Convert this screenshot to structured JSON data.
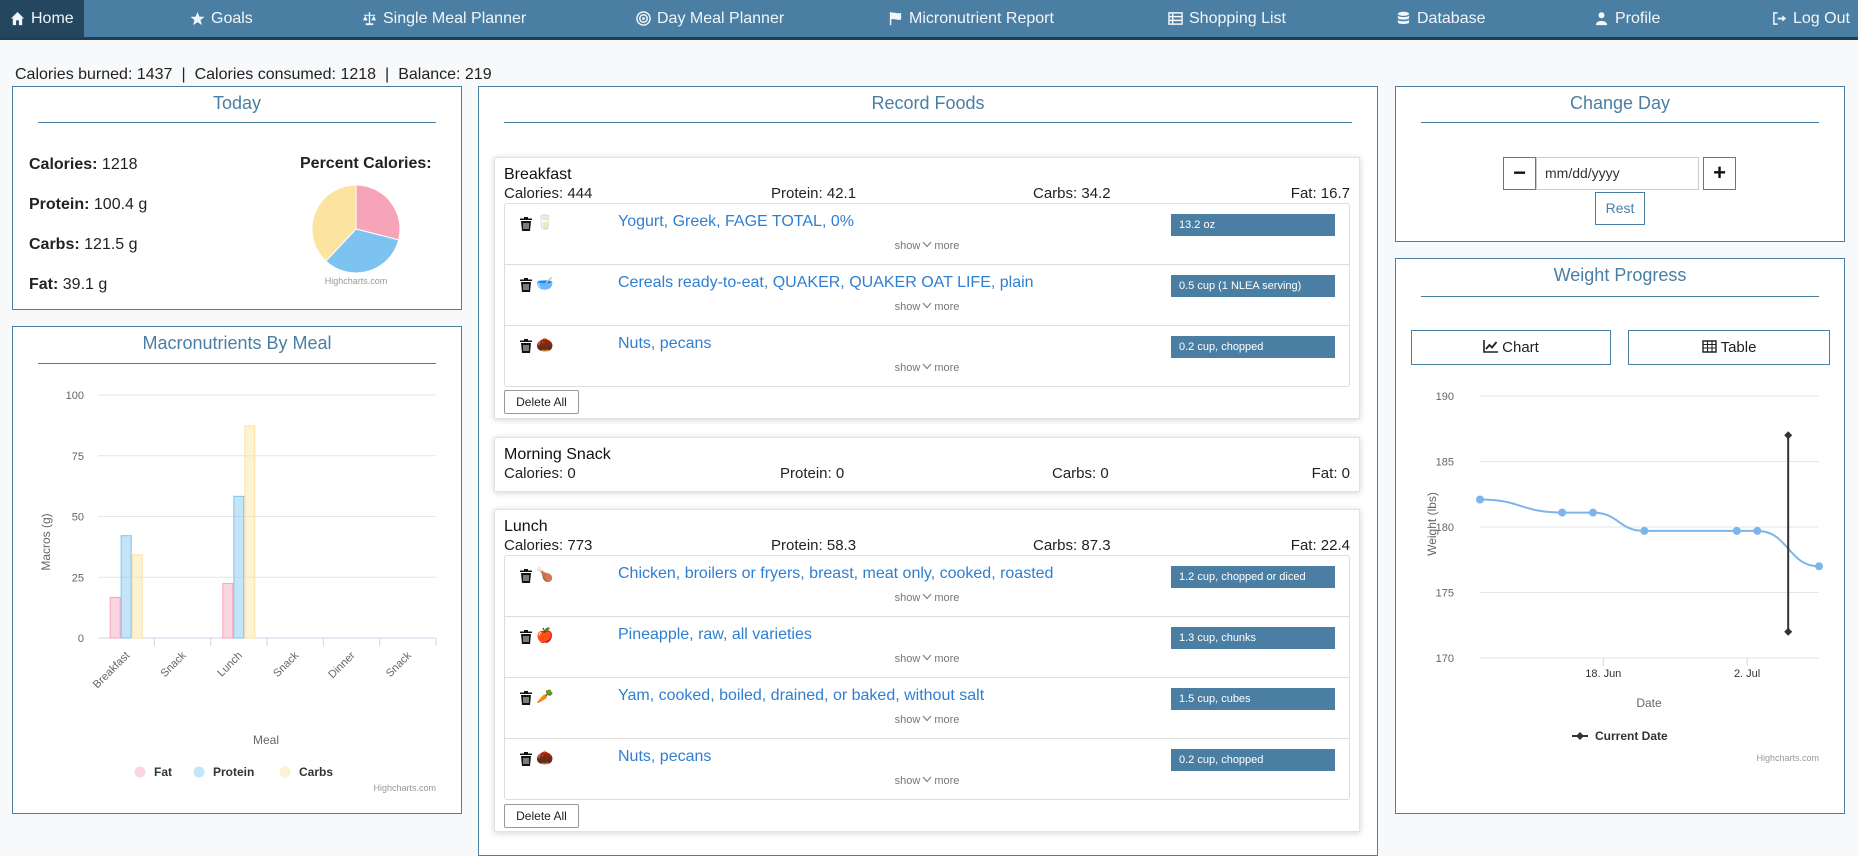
{
  "nav": {
    "items": [
      {
        "label": "Home",
        "icon": "home-icon"
      },
      {
        "label": "Goals",
        "icon": "star-icon"
      },
      {
        "label": "Single Meal Planner",
        "icon": "scale-icon"
      },
      {
        "label": "Day Meal Planner",
        "icon": "target-icon"
      },
      {
        "label": "Micronutrient Report",
        "icon": "flag-icon"
      },
      {
        "label": "Shopping List",
        "icon": "list-icon"
      },
      {
        "label": "Database",
        "icon": "database-icon"
      },
      {
        "label": "Profile",
        "icon": "user-icon"
      },
      {
        "label": "Log Out",
        "icon": "logout-icon"
      }
    ],
    "active": "Home",
    "color": "#4a7fa3"
  },
  "summary": {
    "burned": "Calories burned: 1437",
    "consumed": "Calories consumed: 1218",
    "balance": "Balance: 219",
    "separator": "|"
  },
  "today": {
    "title": "Today",
    "calories_label": "Calories:",
    "calories_value": "1218",
    "protein_label": "Protein:",
    "protein_value": "100.4 g",
    "carbs_label": "Carbs:",
    "carbs_value": "121.5 g",
    "fat_label": "Fat:",
    "fat_value": "39.1 g",
    "pie_label": "Percent Calories:",
    "credits": "Highcharts.com"
  },
  "macros_chart": {
    "title": "Macronutrients By Meal",
    "credits": "Highcharts.com"
  },
  "record": {
    "title": "Record Foods",
    "show": "show",
    "more": "more",
    "delete_all": "Delete All",
    "meals": [
      {
        "name": "Breakfast",
        "calories": "Calories: 444",
        "protein": "Protein: 42.1",
        "carbs": "Carbs: 34.2",
        "fat": "Fat: 16.7",
        "foods": [
          {
            "name": "Yogurt, Greek, FAGE TOTAL, 0%",
            "serving": "13.2 oz",
            "icon": "🥛"
          },
          {
            "name": "Cereals ready-to-eat, QUAKER, QUAKER OAT LIFE, plain",
            "serving": "0.5 cup (1 NLEA serving)",
            "icon": "🥣"
          },
          {
            "name": "Nuts, pecans",
            "serving": "0.2 cup, chopped",
            "icon": "🌰"
          }
        ]
      },
      {
        "name": "Morning Snack",
        "calories": "Calories: 0",
        "protein": "Protein: 0",
        "carbs": "Carbs: 0",
        "fat": "Fat: 0",
        "foods": []
      },
      {
        "name": "Lunch",
        "calories": "Calories: 773",
        "protein": "Protein: 58.3",
        "carbs": "Carbs: 87.3",
        "fat": "Fat: 22.4",
        "foods": [
          {
            "name": "Chicken, broilers or fryers, breast, meat only, cooked, roasted",
            "serving": "1.2 cup, chopped or diced",
            "icon": "🍗"
          },
          {
            "name": "Pineapple, raw, all varieties",
            "serving": "1.3 cup, chunks",
            "icon": "🍎"
          },
          {
            "name": "Yam, cooked, boiled, drained, or baked, without salt",
            "serving": "1.5 cup, cubes",
            "icon": "🥕"
          },
          {
            "name": "Nuts, pecans",
            "serving": "0.2 cup, chopped",
            "icon": "🌰"
          }
        ]
      }
    ]
  },
  "change_day": {
    "title": "Change Day",
    "minus": "−",
    "plus": "+",
    "date_placeholder": "mm/dd/yyyy",
    "rest": "Rest"
  },
  "weight": {
    "title": "Weight Progress",
    "chart_tab": "Chart",
    "table_tab": "Table",
    "credits": "Highcharts.com"
  },
  "chart_data": [
    {
      "type": "pie",
      "title": "Percent Calories:",
      "slices": [
        {
          "label": "Fat",
          "value": 29,
          "color": "#f7a3b8"
        },
        {
          "label": "Protein",
          "value": 33,
          "color": "#7cc3f2"
        },
        {
          "label": "Carbs",
          "value": 38,
          "color": "#fde3a0"
        }
      ]
    },
    {
      "type": "bar",
      "categories": [
        "Breakfast",
        "Snack",
        "Lunch",
        "Snack",
        "Dinner",
        "Snack"
      ],
      "xlabel": "Meal",
      "ylabel": "Macros (g)",
      "ylim": [
        0,
        100
      ],
      "yticks": [
        0,
        25,
        50,
        75,
        100
      ],
      "legend_position": "bottom",
      "series": [
        {
          "name": "Fat",
          "values": [
            16.7,
            0,
            22.4,
            0,
            0,
            0
          ],
          "color": "#f7a3b8"
        },
        {
          "name": "Protein",
          "values": [
            42.1,
            0,
            58.3,
            0,
            0,
            0
          ],
          "color": "#7cc3f2"
        },
        {
          "name": "Carbs",
          "values": [
            34.2,
            0,
            87.3,
            0,
            0,
            0
          ],
          "color": "#fde3a0"
        }
      ]
    },
    {
      "type": "line",
      "xlabel": "Date",
      "ylabel": "Weight (lbs)",
      "ylim": [
        170,
        190
      ],
      "yticks": [
        170,
        175,
        180,
        185,
        190
      ],
      "xticks": [
        {
          "label": "18. Jun",
          "day": 18
        },
        {
          "label": "2. Jul",
          "day": 32
        }
      ],
      "x_range_days": [
        6,
        39
      ],
      "series": [
        {
          "name": "Weight",
          "color": "#7cb5ec",
          "points": [
            [
              6,
              182.1
            ],
            [
              14,
              181.1
            ],
            [
              17,
              181.1
            ],
            [
              22,
              179.7
            ],
            [
              31,
              179.7
            ],
            [
              33,
              179.7
            ],
            [
              39,
              177
            ]
          ]
        }
      ],
      "current_date": {
        "name": "Current Date",
        "day": 36,
        "low": 172,
        "high": 187
      }
    }
  ]
}
